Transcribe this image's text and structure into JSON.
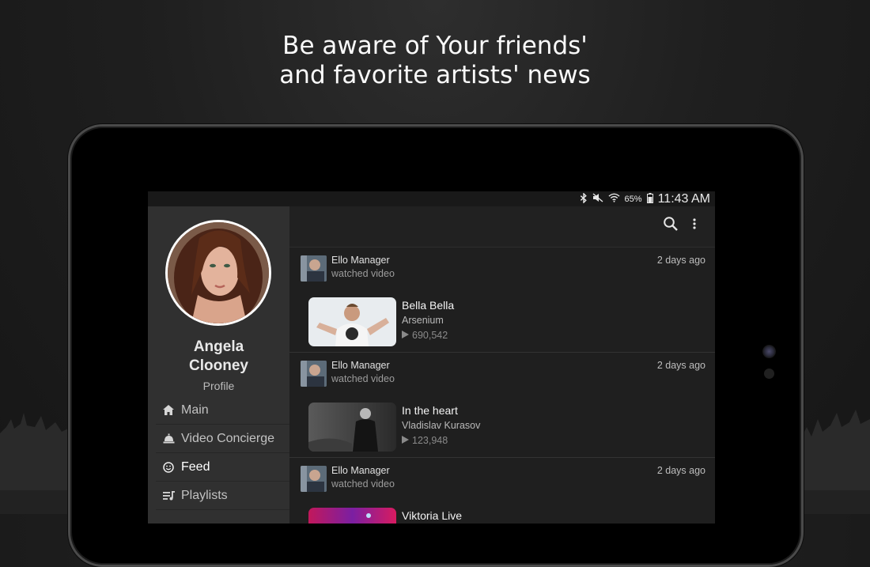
{
  "headline": {
    "line1": "Be aware of Your friends'",
    "line2": "and favorite artists' news"
  },
  "status_bar": {
    "battery_percent": "65%",
    "time": "11:43 AM",
    "icons": [
      "bluetooth-icon",
      "mute-icon",
      "wifi-icon",
      "battery-icon"
    ]
  },
  "drawer": {
    "user": {
      "first_name": "Angela",
      "last_name": "Clooney",
      "subtitle": "Profile"
    },
    "items": [
      {
        "label": "Main",
        "icon": "home-icon",
        "active": false
      },
      {
        "label": "Video Concierge",
        "icon": "concierge-bell-icon",
        "active": false
      },
      {
        "label": "Feed",
        "icon": "smiley-icon",
        "active": true
      },
      {
        "label": "Playlists",
        "icon": "playlist-icon",
        "active": false
      }
    ]
  },
  "appbar": {
    "icons": [
      "search-icon",
      "more-vert-icon"
    ]
  },
  "feed": [
    {
      "user": "Ello Manager",
      "action": "watched video",
      "time": "2 days ago",
      "video": {
        "title": "Bella Bella",
        "artist": "Arsenium",
        "views": "690,542"
      }
    },
    {
      "user": "Ello Manager",
      "action": "watched video",
      "time": "2 days ago",
      "video": {
        "title": "In the heart",
        "artist": "Vladislav Kurasov",
        "views": "123,948"
      }
    },
    {
      "user": "Ello Manager",
      "action": "watched video",
      "time": "2 days ago",
      "video": {
        "title": "Viktoria Live",
        "artist": "",
        "views": ""
      }
    }
  ],
  "colors": {
    "background": "#1f1f1f",
    "drawer": "#303030",
    "screen": "#1e1e1e",
    "text_primary": "#ffffff",
    "text_secondary": "#9c9c9c"
  }
}
